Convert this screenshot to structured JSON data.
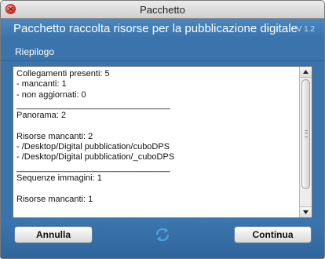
{
  "window": {
    "title": "Pacchetto"
  },
  "header": {
    "title": "Pacchetto raccolta risorse per la pubblicazione digitale",
    "version": "V 1.2"
  },
  "section": {
    "label": "Riepilogo"
  },
  "summary": {
    "text": "Collegamenti presenti: 5\n- mancanti: 1\n- non aggiornati: 0\n________________________________\nPanorama: 2\n\nRisorse mancanti: 2\n- /Desktop/Digital pubblication/cuboDPS\n- /Desktop/Digital pubblication/_cuboDPS\n________________________________\nSequenze immagini: 1\n\nRisorse mancanti: 1"
  },
  "buttons": {
    "cancel": "Annulla",
    "continue": "Continua"
  },
  "icons": {
    "close": "close-icon",
    "refresh": "refresh-icon",
    "scroll_up": "chevron-up-icon",
    "scroll_down": "chevron-down-icon"
  },
  "colors": {
    "panel": "#3b74ad",
    "close": "#e9412f",
    "refresh": "#4aa0e0"
  }
}
